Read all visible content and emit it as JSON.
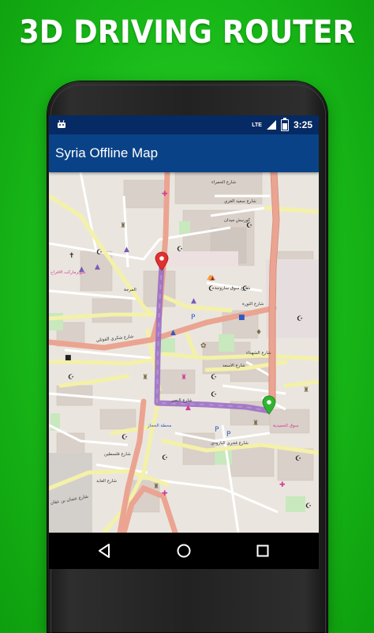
{
  "promo": {
    "headline": "3D DRIVING ROUTER"
  },
  "status_bar": {
    "network": "LTE",
    "time": "3:25"
  },
  "app": {
    "title": "Syria Offline Map"
  },
  "map": {
    "labels": [
      "شارع الحمراء",
      "شارع سعيد الغزي",
      "كورنيش ميدان",
      "شارع سوق ساروجة",
      "شارع الثورة",
      "شارع شكري القوتلي",
      "شارع الشهداء",
      "شارع النصر",
      "شارع فخري البارودي",
      "محطة الحجاز",
      "شارع فلسطين",
      "شارع العابد",
      "شارع الاسعد",
      "سوق الحميدية",
      "شارع عثمان بن عفان",
      "المرجة",
      "سوبرماركت الافراح"
    ]
  },
  "nav": {
    "back": "back-button",
    "home": "home-button",
    "recents": "recents-button"
  },
  "colors": {
    "background": "#18b818",
    "appbar": "#0a4287",
    "statusbar": "#062a63",
    "route": "#9c6fc4",
    "start_pin": "#e0302f",
    "end_pin": "#2fb62f"
  }
}
